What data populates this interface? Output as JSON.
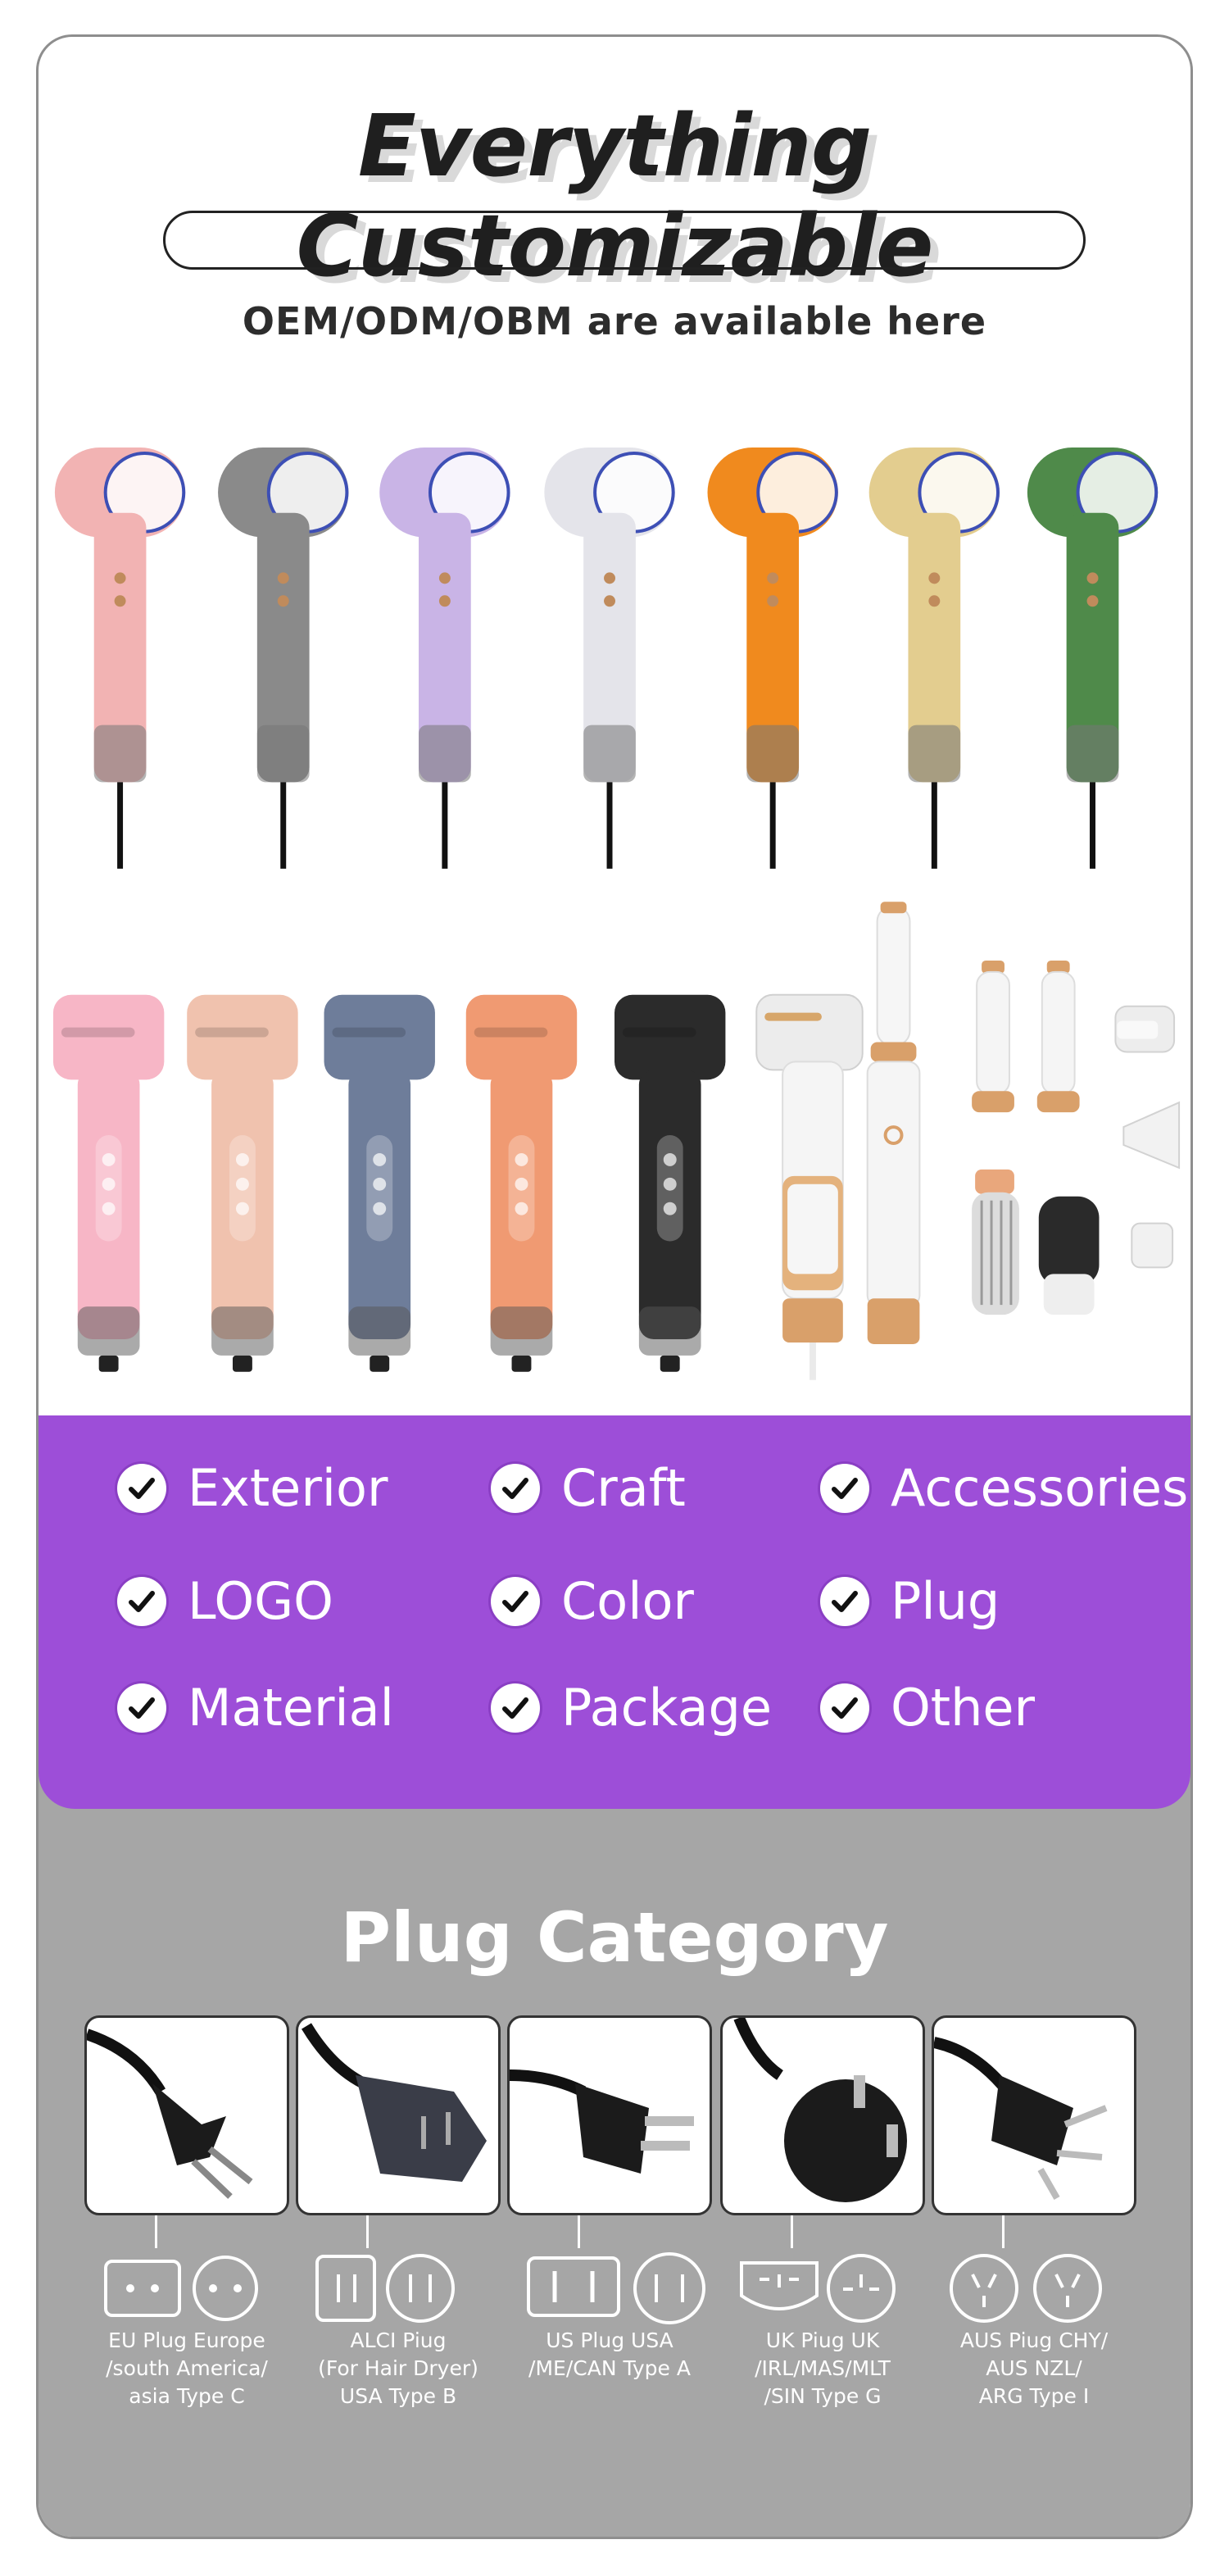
{
  "header": {
    "title": "Everything Customizable",
    "subtitle": "OEM/ODM/OBM are available here"
  },
  "dryers_row1_colors": [
    "#f2b3b3",
    "#8a8a8a",
    "#c9b4e6",
    "#e4e4ea",
    "#f08a1e",
    "#e3cd8f",
    "#4f8a4a"
  ],
  "dryers_row2_colors": [
    "#f7b6c6",
    "#f0c2ae",
    "#6e7d9a",
    "#f09a72",
    "#2b2b2b"
  ],
  "features": [
    {
      "label": "Exterior"
    },
    {
      "label": "Craft"
    },
    {
      "label": "Accessories"
    },
    {
      "label": "LOGO"
    },
    {
      "label": "Color"
    },
    {
      "label": "Plug"
    },
    {
      "label": "Material"
    },
    {
      "label": "Package"
    },
    {
      "label": "Other"
    }
  ],
  "plug_section": {
    "title": "Plug Category",
    "plugs": [
      {
        "line1": "EU Plug Europe",
        "line2": "/south America/",
        "line3": "asia Type C"
      },
      {
        "line1": "ALCI Piug",
        "line2": "(For Hair Dryer)",
        "line3": "USA Type B"
      },
      {
        "line1": "US Plug USA",
        "line2": "/ME/CAN Type A",
        "line3": ""
      },
      {
        "line1": "UK Piug UK",
        "line2": "/IRL/MAS/MLT",
        "line3": "/SIN Type G"
      },
      {
        "line1": "AUS Piug CHY/",
        "line2": "AUS NZL/",
        "line3": "ARG Type I"
      }
    ]
  },
  "colors": {
    "accent_purple": "#9d4ed8",
    "gray_panel": "#a6a6a6"
  }
}
